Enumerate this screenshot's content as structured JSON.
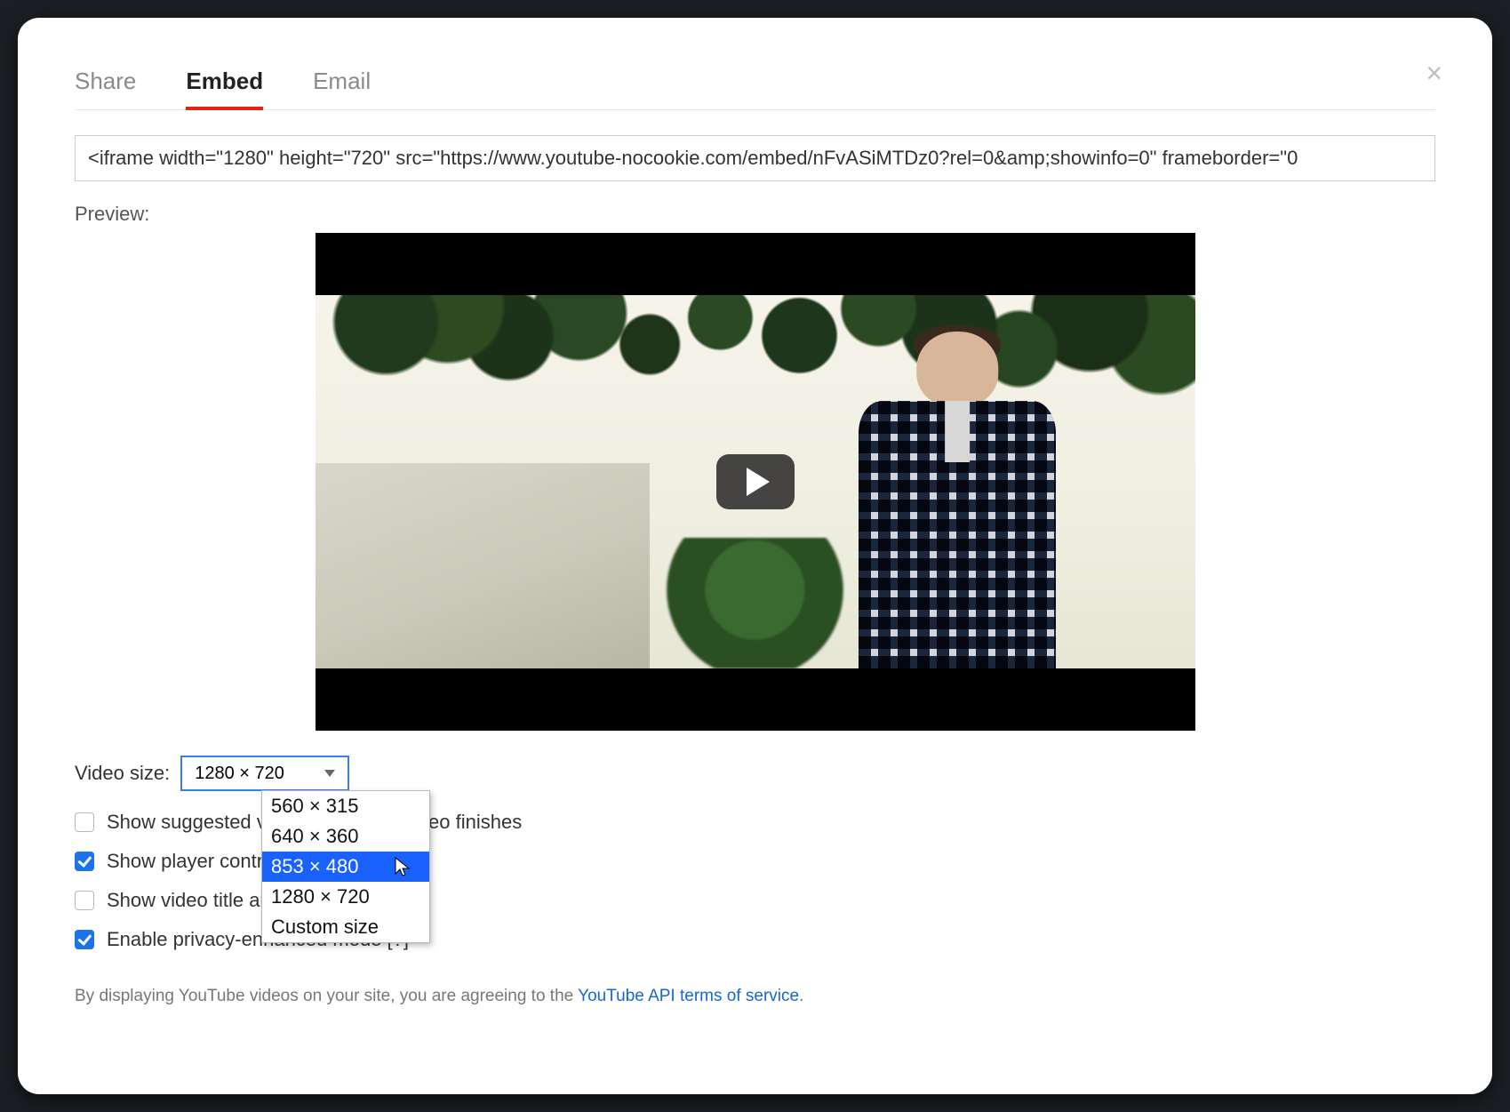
{
  "tabs": {
    "share": "Share",
    "embed": "Embed",
    "email": "Email",
    "active": "embed"
  },
  "embed_code": "<iframe width=\"1280\" height=\"720\" src=\"https://www.youtube-nocookie.com/embed/nFvASiMTDz0?rel=0&amp;showinfo=0\" frameborder=\"0",
  "preview_label": "Preview:",
  "video_size": {
    "label": "Video size:",
    "selected": "1280 × 720",
    "options": [
      "560 × 315",
      "640 × 360",
      "853 × 480",
      "1280 × 720",
      "Custom size"
    ],
    "highlighted": "853 × 480"
  },
  "options": {
    "suggested": {
      "checked": false,
      "label": "Show suggested videos when the video finishes"
    },
    "player_controls": {
      "checked": true,
      "label": "Show player controls"
    },
    "video_title": {
      "checked": false,
      "label": "Show video title and player actions"
    },
    "privacy": {
      "checked": true,
      "label": "Enable privacy-enhanced mode ",
      "help": "[?]"
    }
  },
  "footer": {
    "prefix": "By displaying YouTube videos on your site, you are agreeing to the ",
    "link": "YouTube API terms of service",
    "suffix": "."
  }
}
